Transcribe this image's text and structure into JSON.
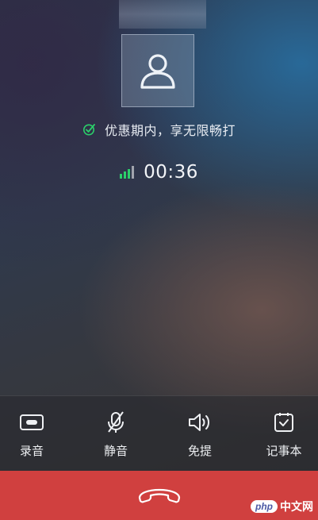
{
  "call": {
    "promo_text": "优惠期内，享无限畅打",
    "duration": "00:36",
    "signal_level": "3/4"
  },
  "icons": {
    "avatar": "person-icon",
    "promo": "check-icon",
    "signal": "signal-bars-icon",
    "hangup": "phone-hangup-icon"
  },
  "actions": [
    {
      "label": "录音",
      "icon": "record-icon"
    },
    {
      "label": "静音",
      "icon": "mute-icon"
    },
    {
      "label": "免提",
      "icon": "speaker-icon"
    },
    {
      "label": "记事本",
      "icon": "notepad-icon"
    }
  ],
  "colors": {
    "accent_green": "#2bd06a",
    "hangup_red": "#d0403f"
  },
  "watermark": {
    "badge": "php",
    "text": "中文网"
  }
}
